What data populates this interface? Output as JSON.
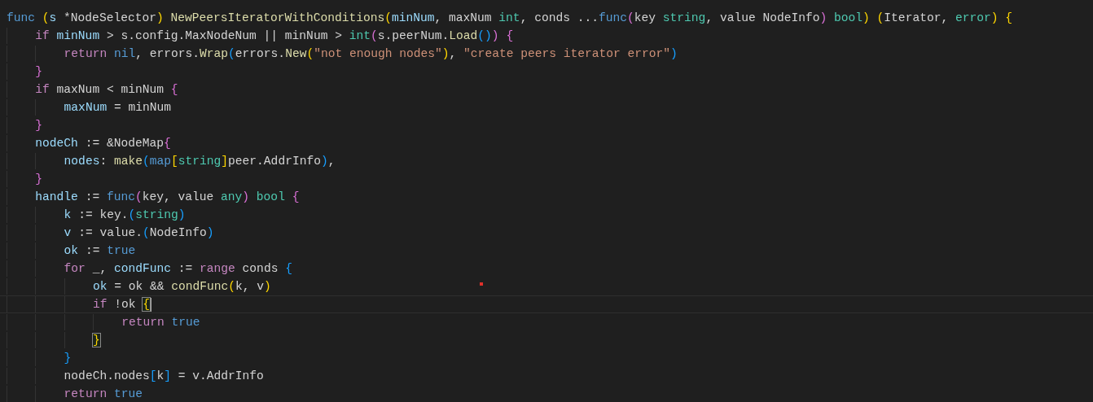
{
  "editor": {
    "lines": [
      {
        "current": false,
        "tokens": [
          {
            "kind": "keyword",
            "text": "func"
          },
          {
            "kind": "bracket1",
            "text": " ("
          },
          {
            "kind": "variable",
            "text": "s"
          },
          {
            "kind": "plain",
            "text": " *NodeSelector"
          },
          {
            "kind": "bracket1",
            "text": ")"
          },
          {
            "kind": "function",
            "text": " NewPeersIteratorWithConditions"
          },
          {
            "kind": "bracket1",
            "text": "("
          },
          {
            "kind": "variable",
            "text": "minNum"
          },
          {
            "kind": "plain",
            "text": ", maxNum"
          },
          {
            "kind": "type",
            "text": " int"
          },
          {
            "kind": "plain",
            "text": ", conds ..."
          },
          {
            "kind": "keyword",
            "text": "func"
          },
          {
            "kind": "bracket2",
            "text": "("
          },
          {
            "kind": "plain",
            "text": "key"
          },
          {
            "kind": "type",
            "text": " string"
          },
          {
            "kind": "plain",
            "text": ", value NodeInfo"
          },
          {
            "kind": "bracket2",
            "text": ")"
          },
          {
            "kind": "type",
            "text": " bool"
          },
          {
            "kind": "bracket1",
            "text": ")"
          },
          {
            "kind": "bracket1",
            "text": " ("
          },
          {
            "kind": "plain",
            "text": "Iterator, "
          },
          {
            "kind": "type",
            "text": "error"
          },
          {
            "kind": "bracket1",
            "text": ")"
          },
          {
            "kind": "bracket1",
            "text": " {"
          }
        ]
      },
      {
        "current": false,
        "tokens": [
          {
            "kind": "control",
            "text": "\tif"
          },
          {
            "kind": "variable",
            "text": " minNum"
          },
          {
            "kind": "plain",
            "text": " > s.config.MaxNodeNum || minNum > "
          },
          {
            "kind": "type",
            "text": "int"
          },
          {
            "kind": "bracket2",
            "text": "("
          },
          {
            "kind": "plain",
            "text": "s.peerNum."
          },
          {
            "kind": "function",
            "text": "Load"
          },
          {
            "kind": "bracket3",
            "text": "("
          },
          {
            "kind": "bracket3",
            "text": ")"
          },
          {
            "kind": "bracket2",
            "text": ")"
          },
          {
            "kind": "bracket2",
            "text": " {"
          }
        ]
      },
      {
        "current": false,
        "tokens": [
          {
            "kind": "control",
            "text": "\t\treturn"
          },
          {
            "kind": "keyword",
            "text": " nil"
          },
          {
            "kind": "plain",
            "text": ", errors."
          },
          {
            "kind": "function",
            "text": "Wrap"
          },
          {
            "kind": "bracket3",
            "text": "("
          },
          {
            "kind": "plain",
            "text": "errors."
          },
          {
            "kind": "function",
            "text": "New"
          },
          {
            "kind": "bracket1",
            "text": "("
          },
          {
            "kind": "string",
            "text": "\"not enough nodes\""
          },
          {
            "kind": "bracket1",
            "text": ")"
          },
          {
            "kind": "plain",
            "text": ", "
          },
          {
            "kind": "string",
            "text": "\"create peers iterator error\""
          },
          {
            "kind": "bracket3",
            "text": ")"
          }
        ]
      },
      {
        "current": false,
        "tokens": [
          {
            "kind": "bracket2",
            "text": "\t}"
          }
        ]
      },
      {
        "current": false,
        "tokens": [
          {
            "kind": "control",
            "text": "\tif"
          },
          {
            "kind": "plain",
            "text": " maxNum < minNum"
          },
          {
            "kind": "bracket2",
            "text": " {"
          }
        ]
      },
      {
        "current": false,
        "tokens": [
          {
            "kind": "variable",
            "text": "\t\tmaxNum"
          },
          {
            "kind": "plain",
            "text": " = minNum"
          }
        ]
      },
      {
        "current": false,
        "tokens": [
          {
            "kind": "bracket2",
            "text": "\t}"
          }
        ]
      },
      {
        "current": false,
        "tokens": [
          {
            "kind": "variable",
            "text": "\tnodeCh"
          },
          {
            "kind": "plain",
            "text": " := &NodeMap"
          },
          {
            "kind": "bracket2",
            "text": "{"
          }
        ]
      },
      {
        "current": false,
        "tokens": [
          {
            "kind": "variable",
            "text": "\t\tnodes"
          },
          {
            "kind": "plain",
            "text": ": "
          },
          {
            "kind": "function",
            "text": "make"
          },
          {
            "kind": "bracket3",
            "text": "("
          },
          {
            "kind": "keyword",
            "text": "map"
          },
          {
            "kind": "bracket1",
            "text": "["
          },
          {
            "kind": "type",
            "text": "string"
          },
          {
            "kind": "bracket1",
            "text": "]"
          },
          {
            "kind": "plain",
            "text": "peer.AddrInfo"
          },
          {
            "kind": "bracket3",
            "text": ")"
          },
          {
            "kind": "plain",
            "text": ","
          }
        ]
      },
      {
        "current": false,
        "tokens": [
          {
            "kind": "bracket2",
            "text": "\t}"
          }
        ]
      },
      {
        "current": false,
        "tokens": [
          {
            "kind": "variable",
            "text": "\thandle"
          },
          {
            "kind": "plain",
            "text": " := "
          },
          {
            "kind": "keyword",
            "text": "func"
          },
          {
            "kind": "bracket2",
            "text": "("
          },
          {
            "kind": "plain",
            "text": "key, value"
          },
          {
            "kind": "type",
            "text": " any"
          },
          {
            "kind": "bracket2",
            "text": ")"
          },
          {
            "kind": "type",
            "text": " bool"
          },
          {
            "kind": "bracket2",
            "text": " {"
          }
        ]
      },
      {
        "current": false,
        "tokens": [
          {
            "kind": "variable",
            "text": "\t\tk"
          },
          {
            "kind": "plain",
            "text": " := key."
          },
          {
            "kind": "bracket3",
            "text": "("
          },
          {
            "kind": "type",
            "text": "string"
          },
          {
            "kind": "bracket3",
            "text": ")"
          }
        ]
      },
      {
        "current": false,
        "tokens": [
          {
            "kind": "variable",
            "text": "\t\tv"
          },
          {
            "kind": "plain",
            "text": " := value."
          },
          {
            "kind": "bracket3",
            "text": "("
          },
          {
            "kind": "plain",
            "text": "NodeInfo"
          },
          {
            "kind": "bracket3",
            "text": ")"
          }
        ]
      },
      {
        "current": false,
        "tokens": [
          {
            "kind": "variable",
            "text": "\t\tok"
          },
          {
            "kind": "plain",
            "text": " := "
          },
          {
            "kind": "keyword",
            "text": "true"
          }
        ]
      },
      {
        "current": false,
        "tokens": [
          {
            "kind": "control",
            "text": "\t\tfor"
          },
          {
            "kind": "plain",
            "text": " _, "
          },
          {
            "kind": "variable",
            "text": "condFunc"
          },
          {
            "kind": "plain",
            "text": " := "
          },
          {
            "kind": "control",
            "text": "range"
          },
          {
            "kind": "plain",
            "text": " conds"
          },
          {
            "kind": "bracket3",
            "text": " {"
          }
        ]
      },
      {
        "current": false,
        "tokens": [
          {
            "kind": "variable",
            "text": "\t\t\tok"
          },
          {
            "kind": "plain",
            "text": " = ok && "
          },
          {
            "kind": "function",
            "text": "condFunc"
          },
          {
            "kind": "bracket1",
            "text": "("
          },
          {
            "kind": "plain",
            "text": "k, v"
          },
          {
            "kind": "bracket1",
            "text": ")"
          }
        ]
      },
      {
        "current": true,
        "tokens": [
          {
            "kind": "control",
            "text": "\t\t\tif"
          },
          {
            "kind": "plain",
            "text": " !ok "
          },
          {
            "kind": "bracket1",
            "text": "{",
            "matched": true
          }
        ]
      },
      {
        "current": false,
        "tokens": [
          {
            "kind": "control",
            "text": "\t\t\t\treturn"
          },
          {
            "kind": "keyword",
            "text": " true"
          }
        ]
      },
      {
        "current": false,
        "tokens": [
          {
            "kind": "bracket1",
            "text": "\t\t\t}",
            "matched": true
          }
        ]
      },
      {
        "current": false,
        "tokens": [
          {
            "kind": "bracket3",
            "text": "\t\t}"
          }
        ]
      },
      {
        "current": false,
        "tokens": [
          {
            "kind": "plain",
            "text": "\t\tnodeCh.nodes"
          },
          {
            "kind": "bracket3",
            "text": "["
          },
          {
            "kind": "plain",
            "text": "k"
          },
          {
            "kind": "bracket3",
            "text": "]"
          },
          {
            "kind": "plain",
            "text": " = v.AddrInfo"
          }
        ]
      },
      {
        "current": false,
        "tokens": [
          {
            "kind": "control",
            "text": "\t\treturn"
          },
          {
            "kind": "keyword",
            "text": " true"
          }
        ]
      }
    ]
  }
}
